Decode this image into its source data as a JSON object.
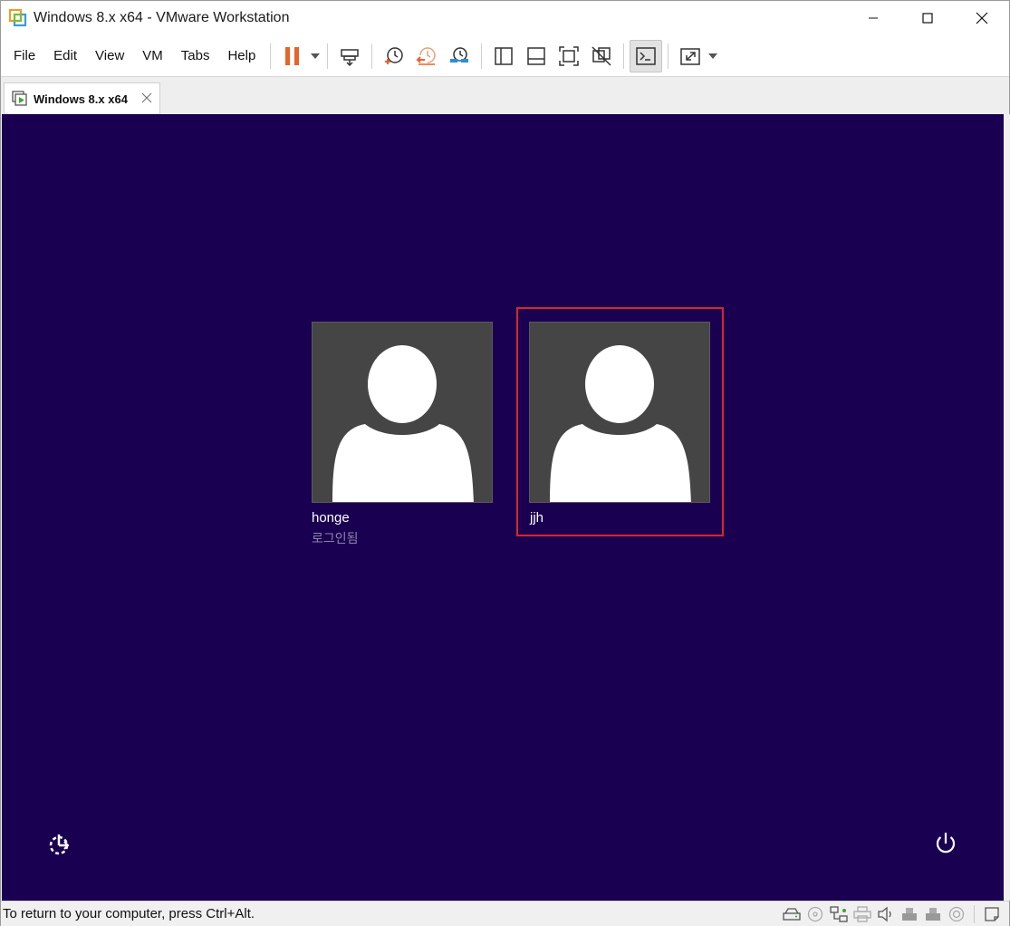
{
  "window": {
    "title": "Windows 8.x x64 - VMware Workstation"
  },
  "menu": {
    "items": [
      "File",
      "Edit",
      "View",
      "VM",
      "Tabs",
      "Help"
    ]
  },
  "toolbar": {
    "icons": [
      "pause-icon",
      "send-keys-icon",
      "snapshot-icon",
      "revert-snapshot-icon",
      "snapshot-manager-icon",
      "sidebar-view-icon",
      "thumbnail-view-icon",
      "fit-guest-icon",
      "unity-disabled-icon",
      "console-view-icon",
      "fullscreen-icon"
    ]
  },
  "tabs": [
    {
      "label": "Windows 8.x x64"
    }
  ],
  "lockscreen": {
    "users": [
      {
        "name": "honge",
        "status": "로그인됨"
      },
      {
        "name": "jjh",
        "status": ""
      }
    ]
  },
  "statusbar": {
    "message": "To return to your computer, press Ctrl+Alt."
  },
  "colors": {
    "vm_background": "#1a0050",
    "selection_border": "#d8262c",
    "tile_background": "#454545",
    "pause_accent": "#e8632a"
  }
}
